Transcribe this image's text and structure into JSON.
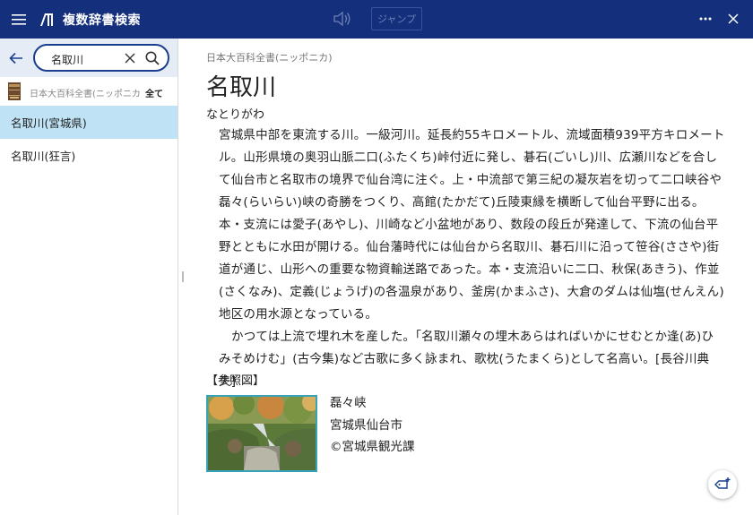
{
  "app": {
    "title": "複数辞書検索",
    "jump_label": "ジャンプ"
  },
  "icons": {
    "menu": "hamburger-menu-icon",
    "logo": "app-logo-icon",
    "speaker": "speaker-icon",
    "more": "more-horizontal-icon",
    "close": "close-icon",
    "back": "back-arrow-icon",
    "clear": "clear-icon",
    "search": "search-icon",
    "book": "book-icon",
    "fab": "note-add-icon"
  },
  "colors": {
    "titlebar": "#14307d",
    "selected_row": "#bfe3f5",
    "searchbar_bg": "#e6ecf5",
    "accent": "#1a3f8f",
    "photo_border": "#36a3b8"
  },
  "search": {
    "query": "名取川"
  },
  "dictionary": {
    "name": "日本大百科全書(ニッポニカ)",
    "filter": "全て"
  },
  "results": [
    {
      "label": "名取川(宮城県)",
      "selected": true
    },
    {
      "label": "名取川(狂言)",
      "selected": false
    }
  ],
  "article": {
    "source": "日本大百科全書(ニッポニカ)",
    "headword": "名取川",
    "reading": "なとりがわ",
    "paragraph1": "宮城県中部を東流する川。一級河川。延長約55キロメートル、流域面積939平方キロメートル。山形県境の奥羽山脈二口(ふたくち)峠付近に発し、碁石(ごいし)川、広瀬川などを合して仙台市と名取市の境界で仙台湾に注ぐ。上・中流部で第三紀の凝灰岩を切って二口峡谷や磊々(らいらい)峡の奇勝をつくり、高館(たかだて)丘陵東縁を横断して仙台平野に出る。本・支流には愛子(あやし)、川崎など小盆地があり、数段の段丘が発達して、下流の仙台平野とともに水田が開ける。仙台藩時代には仙台から名取川、碁石川に沿って笹谷(ささや)街道が通じ、山形への重要な物資輸送路であった。本・支流沿いに二口、秋保(あきう)、作並(さくなみ)、定義(じょうげ)の各温泉があり、釜房(かまふさ)、大倉のダムは仙塩(せんえん)地区の用水源となっている。",
    "paragraph2": "かつては上流で埋れ木を産した。「名取川瀬々の埋木あらはればいかにせむとか逢(あ)ひみそめけむ」(古今集)など古歌に多く詠まれ、歌枕(うたまくら)として名高い。[長谷川典夫]",
    "refs_label": "【参照図】",
    "figure": {
      "caption_line1": "磊々峡",
      "caption_line2": "宮城県仙台市",
      "caption_line3": "©宮城県観光課"
    }
  }
}
